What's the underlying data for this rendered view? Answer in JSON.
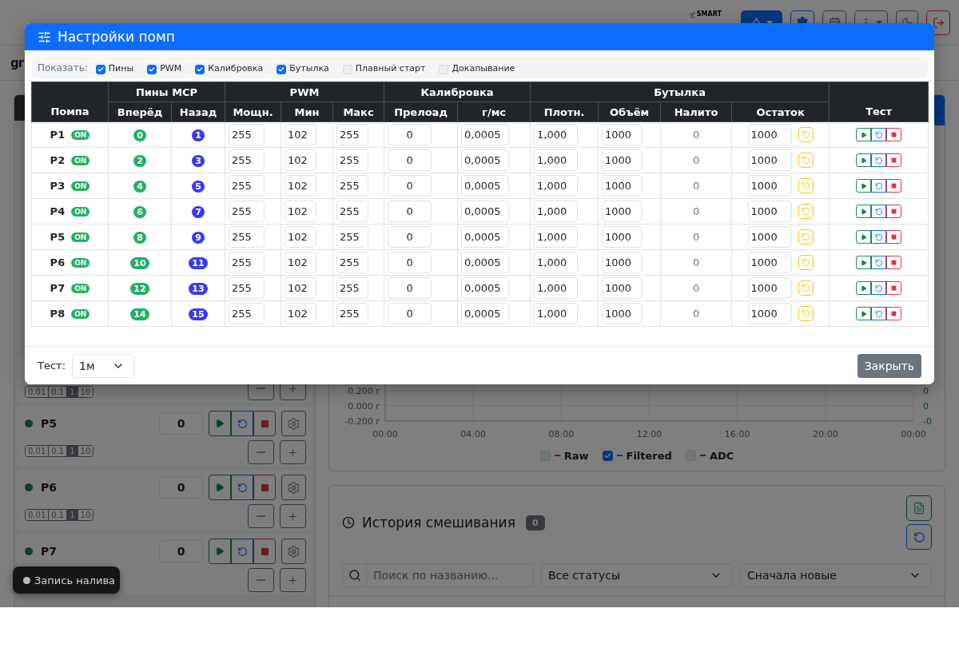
{
  "header": {
    "logo_text": "SMART"
  },
  "page_title": "gr",
  "pump_panel": {
    "rows": [
      {
        "kind": "partial",
        "steps": [
          {
            "label": "0.01",
            "selected": false
          },
          {
            "label": "0.1",
            "selected": false
          },
          {
            "label": "1",
            "selected": true
          },
          {
            "label": "10",
            "selected": false
          }
        ]
      },
      {
        "kind": "full",
        "name": "P5",
        "value": "0",
        "steps": [
          {
            "label": "0.01",
            "selected": false
          },
          {
            "label": "0.1",
            "selected": false
          },
          {
            "label": "1",
            "selected": true
          },
          {
            "label": "10",
            "selected": false
          }
        ]
      },
      {
        "kind": "full",
        "name": "P6",
        "value": "0",
        "steps": [
          {
            "label": "0.01",
            "selected": false
          },
          {
            "label": "0.1",
            "selected": false
          },
          {
            "label": "1",
            "selected": true
          },
          {
            "label": "10",
            "selected": false
          }
        ]
      },
      {
        "kind": "full",
        "name": "P7",
        "value": "0"
      }
    ]
  },
  "chart": {
    "chart_data": {
      "type": "line",
      "grid": true,
      "xlim": [
        0,
        24
      ],
      "ylim": [
        -0.2,
        0.2
      ],
      "xticks": [
        {
          "value": 0,
          "label": "00:00"
        },
        {
          "value": 4,
          "label": "04:00"
        },
        {
          "value": 8,
          "label": "08:00"
        },
        {
          "value": 12,
          "label": "12:00"
        },
        {
          "value": 16,
          "label": "16:00"
        },
        {
          "value": 20,
          "label": "20:00"
        },
        {
          "value": 24,
          "label": "00:00"
        }
      ],
      "yticks": [
        {
          "value": 0.2,
          "label": "0.200 г"
        },
        {
          "value": 0,
          "label": "0.000 г"
        },
        {
          "value": -0.2,
          "label": "-0.200 г"
        }
      ]
    },
    "right_ticks": [
      "0",
      "0",
      "-0"
    ],
    "legend": [
      {
        "label": "Raw",
        "checked": false,
        "color": "#6e1b23"
      },
      {
        "label": "Filtered",
        "checked": true,
        "color": "#06377f"
      },
      {
        "label": "ADC",
        "checked": false,
        "color": "#0c442a"
      }
    ]
  },
  "history": {
    "title": "История смешивания",
    "count": "0",
    "search_placeholder": "Поиск по названию...",
    "status_filter": "Все статусы",
    "sort_order": "Сначала новые"
  },
  "toast": {
    "label": "Запись налива"
  },
  "modal": {
    "title": "Настройки помп",
    "show_label": "Показать:",
    "filters": [
      {
        "label": "Пины",
        "checked": true
      },
      {
        "label": "PWM",
        "checked": true
      },
      {
        "label": "Калибровка",
        "checked": true
      },
      {
        "label": "Бутылка",
        "checked": true
      },
      {
        "label": "Плавный старт",
        "checked": false
      },
      {
        "label": "Докапывание",
        "checked": false
      }
    ],
    "table": {
      "columns": [
        {
          "label": "Помпа"
        },
        {
          "label": "Пины MCP",
          "children": [
            {
              "label": "Вперёд"
            },
            {
              "label": "Назад"
            }
          ]
        },
        {
          "label": "PWM",
          "children": [
            {
              "label": "Мощн."
            },
            {
              "label": "Мин"
            },
            {
              "label": "Макс"
            }
          ]
        },
        {
          "label": "Калибровка",
          "children": [
            {
              "label": "Прелоад"
            },
            {
              "label": "г/мс"
            }
          ]
        },
        {
          "label": "Бутылка",
          "children": [
            {
              "label": "Плотн."
            },
            {
              "label": "Объём"
            },
            {
              "label": "Налито"
            },
            {
              "label": "Остаток"
            }
          ]
        },
        {
          "label": "Тест"
        }
      ],
      "rows": [
        {
          "pump": "P1",
          "status": "ON",
          "forward_pin": "0",
          "reverse_pin": "1",
          "power": "255",
          "min": "102",
          "max": "255",
          "preload": "0",
          "rate": "0,0005",
          "density": "1,000",
          "volume": "1000",
          "poured": "0",
          "remaining": "1000"
        },
        {
          "pump": "P2",
          "status": "ON",
          "forward_pin": "2",
          "reverse_pin": "3",
          "power": "255",
          "min": "102",
          "max": "255",
          "preload": "0",
          "rate": "0,0005",
          "density": "1,000",
          "volume": "1000",
          "poured": "0",
          "remaining": "1000"
        },
        {
          "pump": "P3",
          "status": "ON",
          "forward_pin": "4",
          "reverse_pin": "5",
          "power": "255",
          "min": "102",
          "max": "255",
          "preload": "0",
          "rate": "0,0005",
          "density": "1,000",
          "volume": "1000",
          "poured": "0",
          "remaining": "1000"
        },
        {
          "pump": "P4",
          "status": "ON",
          "forward_pin": "6",
          "reverse_pin": "7",
          "power": "255",
          "min": "102",
          "max": "255",
          "preload": "0",
          "rate": "0,0005",
          "density": "1,000",
          "volume": "1000",
          "poured": "0",
          "remaining": "1000"
        },
        {
          "pump": "P5",
          "status": "ON",
          "forward_pin": "8",
          "reverse_pin": "9",
          "power": "255",
          "min": "102",
          "max": "255",
          "preload": "0",
          "rate": "0,0005",
          "density": "1,000",
          "volume": "1000",
          "poured": "0",
          "remaining": "1000"
        },
        {
          "pump": "P6",
          "status": "ON",
          "forward_pin": "10",
          "reverse_pin": "11",
          "power": "255",
          "min": "102",
          "max": "255",
          "preload": "0",
          "rate": "0,0005",
          "density": "1,000",
          "volume": "1000",
          "poured": "0",
          "remaining": "1000"
        },
        {
          "pump": "P7",
          "status": "ON",
          "forward_pin": "12",
          "reverse_pin": "13",
          "power": "255",
          "min": "102",
          "max": "255",
          "preload": "0",
          "rate": "0,0005",
          "density": "1,000",
          "volume": "1000",
          "poured": "0",
          "remaining": "1000"
        },
        {
          "pump": "P8",
          "status": "ON",
          "forward_pin": "14",
          "reverse_pin": "15",
          "power": "255",
          "min": "102",
          "max": "255",
          "preload": "0",
          "rate": "0,0005",
          "density": "1,000",
          "volume": "1000",
          "poured": "0",
          "remaining": "1000"
        }
      ]
    },
    "footer": {
      "test_label": "Тест:",
      "test_duration": "1м",
      "close_label": "Закрыть"
    }
  }
}
